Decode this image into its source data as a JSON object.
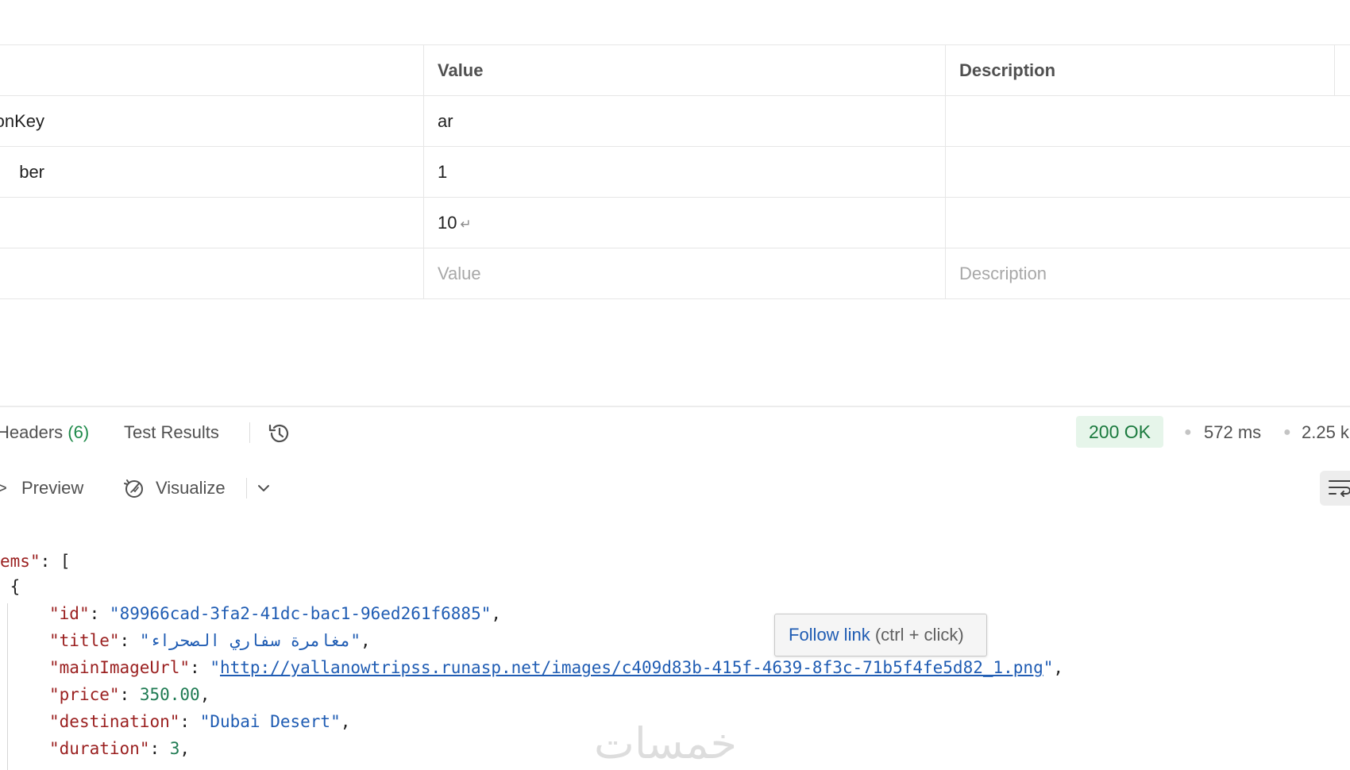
{
  "params": {
    "headers": {
      "key": "",
      "value": "Value",
      "description": "Description"
    },
    "rows": [
      {
        "key": "onKey",
        "value": "ar",
        "description": ""
      },
      {
        "key": "ber",
        "value": "1",
        "description": ""
      },
      {
        "key": "",
        "value": "10",
        "description": "",
        "value_suffix": "↵"
      }
    ],
    "placeholder_row": {
      "value": "Value",
      "description": "Description"
    }
  },
  "response": {
    "tabs": {
      "headers_label": "Headers",
      "headers_count": "(6)",
      "test_results_label": "Test Results"
    },
    "status": "200 OK",
    "time": "572 ms",
    "size": "2.25 k",
    "status_color": "#1b7a3e"
  },
  "view": {
    "preview_label": "Preview",
    "visualize_label": "Visualize"
  },
  "json_view": {
    "open_key": "ems",
    "item": {
      "id_key": "id",
      "id": "89966cad-3fa2-41dc-bac1-96ed261f6885",
      "title_key": "title",
      "title": "مغامرة سفاري الصحراء",
      "image_key": "mainImageUrl",
      "image_url": "http://yallanowtripss.runasp.net/images/c409d83b-415f-4639-8f3c-71b5f4fe5d82_1.png",
      "price_key": "price",
      "price": "350.00",
      "destination_key": "destination",
      "destination": "Dubai Desert",
      "duration_key": "duration",
      "duration": "3"
    }
  },
  "tooltip": {
    "follow": "Follow link",
    "hint": "(ctrl + click)"
  },
  "watermark": "خمسات"
}
